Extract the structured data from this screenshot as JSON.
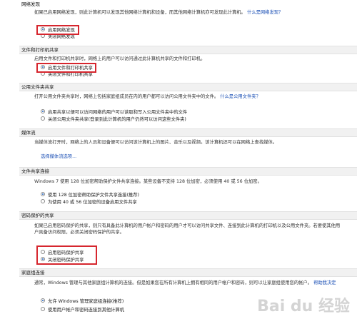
{
  "network_discovery": {
    "title": "网络发现",
    "desc": "如果已启用网络发现，则此计算机可以发现其他网络计算机和设备，而其他网络计算机亦可发现此计算机。",
    "link": "什么是网络发现？",
    "options": [
      "启用网络发现",
      "关闭网络发现"
    ]
  },
  "file_printer_sharing": {
    "title": "文件和打印机共享",
    "desc": "启用文件和打印机共享时，网络上的用户可以访问通过此计算机共享的文件和打印机。",
    "options": [
      "启用文件和打印机共享",
      "关闭文件和打印机共享"
    ]
  },
  "public_folder_sharing": {
    "title": "公用文件夹共享",
    "desc": "打开公用文件夹共享时，网络上包括家庭组成员在内的用户都可以访问公用文件夹中的文件。",
    "link": "什么是公用文件夹？",
    "options": [
      "启用共享以便可以访问网络的用户可以读取和写入公用文件夹中的文件",
      "关闭公用文件夹共享(登录到此计算机的用户仍然可以访问这些文件夹)"
    ]
  },
  "media_streaming": {
    "title": "媒体流",
    "desc": "当媒体流打开时，网络上的人员和设备便可以访问该计算机上的图片、音乐以及视频。该计算机还可以在网络上查找媒体。",
    "link": "选择媒体流选项..."
  },
  "file_sharing_connections": {
    "title": "文件共享连接",
    "desc": "Windows 7 使用 128 位加密帮助保护文件共享连接。某些设备不支持 128 位加密，必须使用 40 或 56 位加密。",
    "options": [
      "使用 128 位加密帮助保护文件共享连接(推荐)",
      "为使用 40 或 56 位加密的设备启用文件共享"
    ]
  },
  "password_protected_sharing": {
    "title": "密码保护的共享",
    "desc": "如果已启用密码保护的共享，则只有具备此计算机的用户帐户和密码的用户才可以访问共享文件、连接到此计算机的打印机以及公用文件夹。若要使其他用户具备访问权限，必须关闭密码保护的共享。",
    "options": [
      "启用密码保护共享",
      "关闭密码保护共享"
    ]
  },
  "homegroup_connections": {
    "title": "家庭组连接",
    "desc": "通常，Windows 管理与其他家庭组计算机的连接。但是如果您在所有计算机上拥有相同的用户帐户和密码，则可以让家庭组使用您的帐户。",
    "link": "帮助我决定",
    "options": [
      "允许 Windows 管理家庭组连接(推荐)",
      "使用用户帐户和密码连接到其他计算机"
    ]
  },
  "watermark": "Bai du 经验"
}
